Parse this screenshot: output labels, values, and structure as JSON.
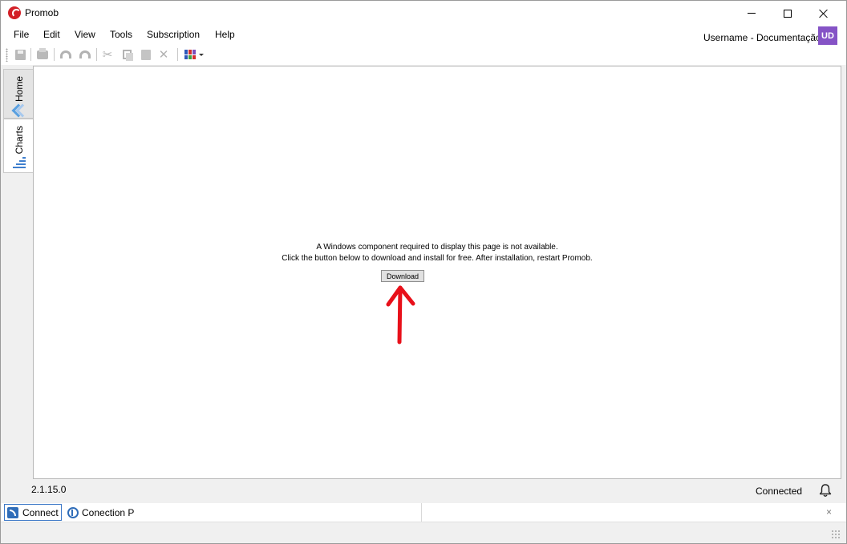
{
  "window": {
    "title": "Promob"
  },
  "menu": {
    "items": [
      "File",
      "Edit",
      "View",
      "Tools",
      "Subscription",
      "Help"
    ],
    "user_label": "Username - Documentação",
    "user_initials": "UD"
  },
  "sidetabs": {
    "home_label": "Home",
    "charts_label": "Charts"
  },
  "content": {
    "message_line1": "A Windows component required to display this page is not available.",
    "message_line2": "Click the button below to download and install for free. After installation, restart Promob.",
    "download_label": "Download"
  },
  "status": {
    "version": "2.1.15.0",
    "connection": "Connected"
  },
  "bottom_tabs": {
    "connect_label": "Connect",
    "conection_label": "Conection P",
    "close_glyph": "×"
  },
  "colors": {
    "accent": "#2f6db9",
    "avatar": "#8553c6",
    "annotation_arrow": "#e8101a"
  }
}
